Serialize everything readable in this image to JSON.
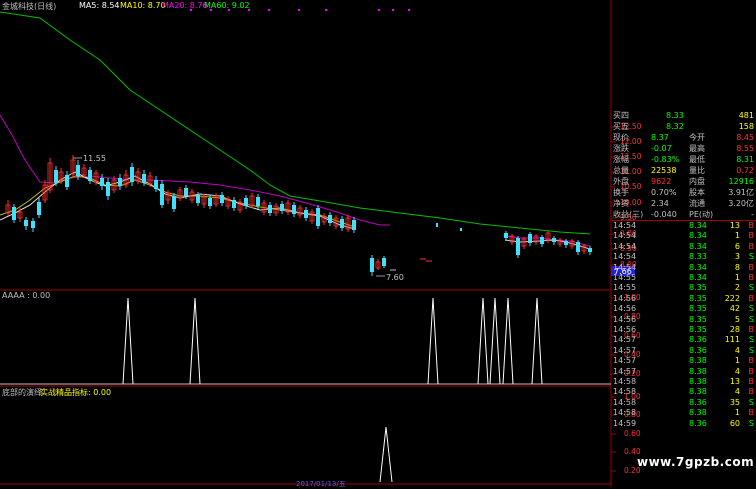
{
  "header": {
    "title": "金城科技(日线)",
    "ma5_label": "MA5: 8.54",
    "ma10_label": "MA10: 8.70",
    "ma20_label": "MA20: 8.76",
    "ma60_label": "MA60: 9.02",
    "colors": {
      "title": "#c0c0c0",
      "ma5": "#ffffff",
      "ma10": "#ffff00",
      "ma20": "#ff00ff",
      "ma60": "#00ff00"
    }
  },
  "price_axis": [
    "12.50",
    "12.00",
    "11.50",
    "11.00",
    "10.50",
    "10.00",
    "9.50",
    "9.00",
    "8.50",
    "8.00"
  ],
  "price_annotations": {
    "high": "11.55",
    "low": "7.60",
    "current": "7.66"
  },
  "indicator1": {
    "label": "AAAA : 0.00",
    "axis": [
      "1.00",
      "0.80",
      "0.60",
      "0.40",
      "0.20"
    ]
  },
  "indicator2": {
    "label": "底部的演绎",
    "sublabel": "实战精品指标: 0.00",
    "axis": [
      "1.00",
      "0.80",
      "0.60",
      "0.40",
      "0.20"
    ]
  },
  "footer": {
    "date": "2017/01/13/五"
  },
  "quote": [
    {
      "k1": "买四",
      "v1": "8.33",
      "v2": "481",
      "c1": "#00ff00",
      "c2": "#ffff00"
    },
    {
      "k1": "买五",
      "v1": "8.32",
      "v2": "158",
      "c1": "#00ff00",
      "c2": "#ffff00"
    },
    {
      "k1": "现价",
      "v1": "8.37",
      "k2": "今开",
      "v2": "8.45",
      "c1": "#00ff00",
      "c2": "#ff3030"
    },
    {
      "k1": "涨跌",
      "v1": "-0.07",
      "k2": "最高",
      "v2": "8.55",
      "c1": "#00ff00",
      "c2": "#ff3030"
    },
    {
      "k1": "涨幅",
      "v1": "-0.83%",
      "k2": "最低",
      "v2": "8.31",
      "c1": "#00ff00",
      "c2": "#00ff00"
    },
    {
      "k1": "总量",
      "v1": "22538",
      "k2": "量比",
      "v2": "0.72",
      "c1": "#ffff00",
      "c2": "#ff3030"
    },
    {
      "k1": "外盘",
      "v1": "9622",
      "k2": "内盘",
      "v2": "12916",
      "c1": "#ff3030",
      "c2": "#00ff00"
    },
    {
      "k1": "换手",
      "v1": "0.70%",
      "k2": "股本",
      "v2": "3.91亿",
      "c1": "#c0c0c0",
      "c2": "#c0c0c0"
    },
    {
      "k1": "净资",
      "v1": "2.34",
      "k2": "流通",
      "v2": "3.20亿",
      "c1": "#c0c0c0",
      "c2": "#c0c0c0"
    },
    {
      "k1": "收益(三)",
      "v1": "-0.040",
      "k2": "PE(动)",
      "v2": "-",
      "c1": "#c0c0c0",
      "c2": "#c0c0c0"
    }
  ],
  "ticks": [
    {
      "time": "14:54",
      "price": "8.34",
      "vol": "13",
      "bs": "B",
      "bc": "#ff3030"
    },
    {
      "time": "14:54",
      "price": "8.34",
      "vol": "1",
      "bs": "B",
      "bc": "#ff3030"
    },
    {
      "time": "14:54",
      "price": "8.34",
      "vol": "6",
      "bs": "B",
      "bc": "#ff3030"
    },
    {
      "time": "14:54",
      "price": "8.33",
      "vol": "3",
      "bs": "S",
      "bc": "#00ff00"
    },
    {
      "time": "14:54",
      "price": "8.34",
      "vol": "8",
      "bs": "B",
      "bc": "#ff3030"
    },
    {
      "time": "14:55",
      "price": "8.34",
      "vol": "1",
      "bs": "B",
      "bc": "#ff3030"
    },
    {
      "time": "14:55",
      "price": "8.35",
      "vol": "2",
      "bs": "S",
      "bc": "#00ff00"
    },
    {
      "time": "14:56",
      "price": "8.35",
      "vol": "222",
      "bs": "B",
      "bc": "#ff3030"
    },
    {
      "time": "14:56",
      "price": "8.35",
      "vol": "42",
      "bs": "S",
      "bc": "#00ff00"
    },
    {
      "time": "14:56",
      "price": "8.35",
      "vol": "5",
      "bs": "S",
      "bc": "#00ff00"
    },
    {
      "time": "14:56",
      "price": "8.35",
      "vol": "28",
      "bs": "B",
      "bc": "#ff3030"
    },
    {
      "time": "14:57",
      "price": "8.36",
      "vol": "111",
      "bs": "S",
      "bc": "#00ff00"
    },
    {
      "time": "14:57",
      "price": "8.36",
      "vol": "4",
      "bs": "S",
      "bc": "#00ff00"
    },
    {
      "time": "14:57",
      "price": "8.38",
      "vol": "1",
      "bs": "B",
      "bc": "#ff3030"
    },
    {
      "time": "14:57",
      "price": "8.38",
      "vol": "4",
      "bs": "B",
      "bc": "#ff3030"
    },
    {
      "time": "14:58",
      "price": "8.38",
      "vol": "13",
      "bs": "B",
      "bc": "#ff3030"
    },
    {
      "time": "14:58",
      "price": "8.38",
      "vol": "4",
      "bs": "B",
      "bc": "#ff3030"
    },
    {
      "time": "14:58",
      "price": "8.36",
      "vol": "35",
      "bs": "S",
      "bc": "#00ff00"
    },
    {
      "time": "14:58",
      "price": "8.38",
      "vol": "1",
      "bs": "B",
      "bc": "#ff3030"
    },
    {
      "time": "14:59",
      "price": "8.36",
      "vol": "60",
      "bs": "S",
      "bc": "#00ff00"
    }
  ],
  "watermark": "www.7gpzb.com"
}
